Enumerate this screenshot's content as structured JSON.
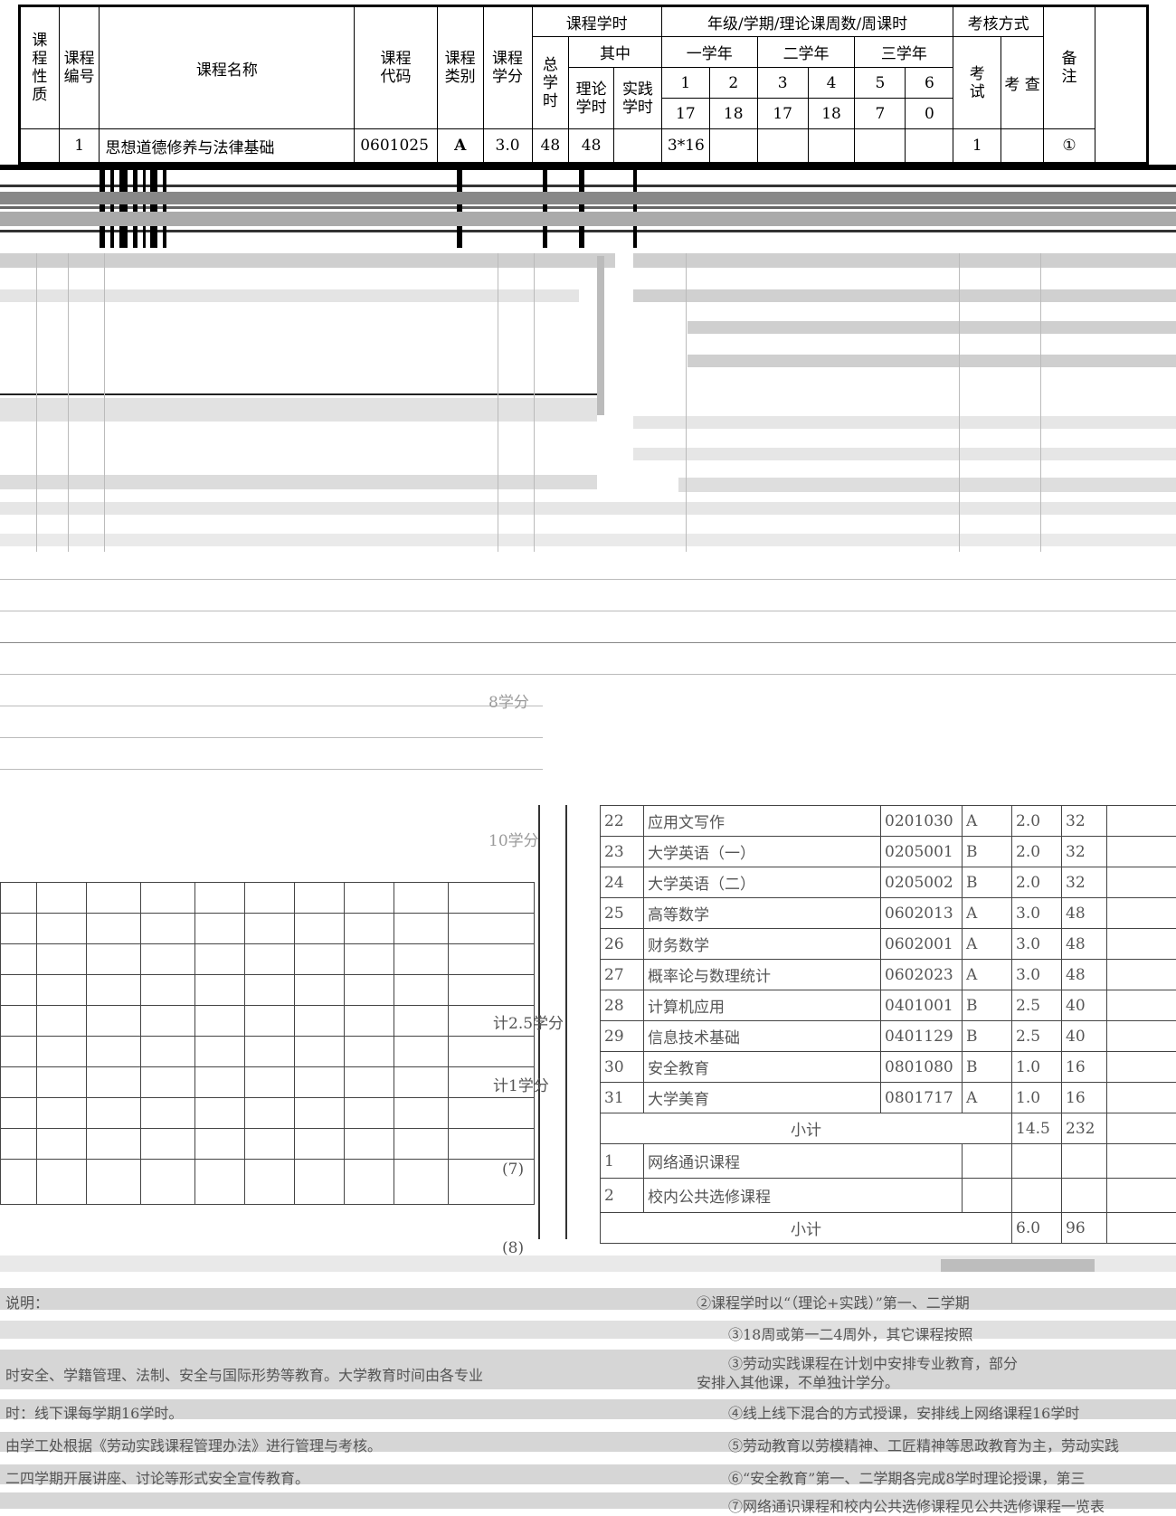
{
  "header": {
    "col_nature": "课程性质",
    "col_no": "课程编号",
    "col_name": "课程名称",
    "col_code": "课程代码",
    "col_type": "课程类别",
    "col_credit": "课程学分",
    "group_hours": "课程学时",
    "total_hours": "总学时",
    "of_which": "其中",
    "theory_hours": "理论学时",
    "practice_hours": "实践学时",
    "group_grade": "年级/学期/理论课周数/周课时",
    "year1": "一学年",
    "year2": "二学年",
    "year3": "三学年",
    "terms": [
      "1",
      "2",
      "3",
      "4",
      "5",
      "6"
    ],
    "weeks": [
      "17",
      "18",
      "17",
      "18",
      "7",
      "0"
    ],
    "group_assess": "考核方式",
    "exam": "考试",
    "check": "考 查",
    "remark": "备注"
  },
  "rows": [
    {
      "no": "1",
      "name": "思想道德修养与法律基础",
      "code": "0601025",
      "type": "A",
      "credit": "3.0",
      "total": "48",
      "theory": "48",
      "practice": "",
      "t1": "3*16",
      "t2": "",
      "t3": "",
      "t4": "",
      "t5": "",
      "t6": "",
      "exam": "1",
      "check": "",
      "remark": "①"
    }
  ],
  "degraded": {
    "right_rows": [
      {
        "no": "22",
        "name": "应用文写作",
        "code": "0201030",
        "type": "A",
        "credit": "2.0",
        "hours": "32"
      },
      {
        "no": "23",
        "name": "大学英语（一）",
        "code": "0205001",
        "type": "B",
        "credit": "2.0",
        "hours": "32"
      },
      {
        "no": "24",
        "name": "大学英语（二）",
        "code": "0205002",
        "type": "B",
        "credit": "2.0",
        "hours": "32"
      },
      {
        "no": "25",
        "name": "高等数学",
        "code": "0602013",
        "type": "A",
        "credit": "3.0",
        "hours": "48"
      },
      {
        "no": "26",
        "name": "财务数学",
        "code": "0602001",
        "type": "A",
        "credit": "3.0",
        "hours": "48"
      },
      {
        "no": "27",
        "name": "概率论与数理统计",
        "code": "0602023",
        "type": "A",
        "credit": "3.0",
        "hours": "48"
      },
      {
        "no": "28",
        "name": "计算机应用",
        "code": "0401001",
        "type": "B",
        "credit": "2.5",
        "hours": "40"
      },
      {
        "no": "29",
        "name": "信息技术基础",
        "code": "0401129",
        "type": "B",
        "credit": "2.5",
        "hours": "40"
      },
      {
        "no": "30",
        "name": "安全教育",
        "code": "0801080",
        "type": "B",
        "credit": "1.0",
        "hours": "16"
      },
      {
        "no": "31",
        "name": "大学美育",
        "code": "0801717",
        "type": "A",
        "credit": "1.0",
        "hours": "16"
      }
    ],
    "subtotal_label": "小计",
    "subtotal_credit": "14.5",
    "subtotal_hours": "232",
    "public_rows": [
      {
        "no": "1",
        "name": "网络通识课程"
      },
      {
        "no": "2",
        "name": "校内公共选修课程"
      }
    ],
    "public_subtotal_credit": "6.0",
    "public_subtotal_hours": "96",
    "footer_left": [
      "说明：",
      "时安全、学籍管理、法制、安全与国际形势等教育。大学教育时间由各专业",
      "时：线下课每学期16学时。",
      "由学工处根据《劳动实践课程管理办法》进行管理与考核。",
      "二四学期开展讲座、讨论等形式安全宣传教育。"
    ],
    "footer_right": [
      "②课程学时以“（理论+实践）”第一、二学期",
      "③18周或第一二4周外，其它课程按照",
      "③劳动实践课程在计划中安排专业教育，部分",
      "安排入其他课，不单独计学分。",
      "④线上线下混合的方式授课，安排线上网络课程16学时",
      "⑤劳动教育以劳模精神、工匠精神等思政教育为主，劳动实践",
      "⑥“安全教育”第一、二学期各完成8学时理论授课，第三",
      "⑦网络通识课程和校内公共选修课程见公共选修课程一览表"
    ],
    "left_notes": [
      "8学分",
      "10学分",
      "计2.5学分",
      "计1学分",
      "(7)",
      "(8)"
    ]
  }
}
